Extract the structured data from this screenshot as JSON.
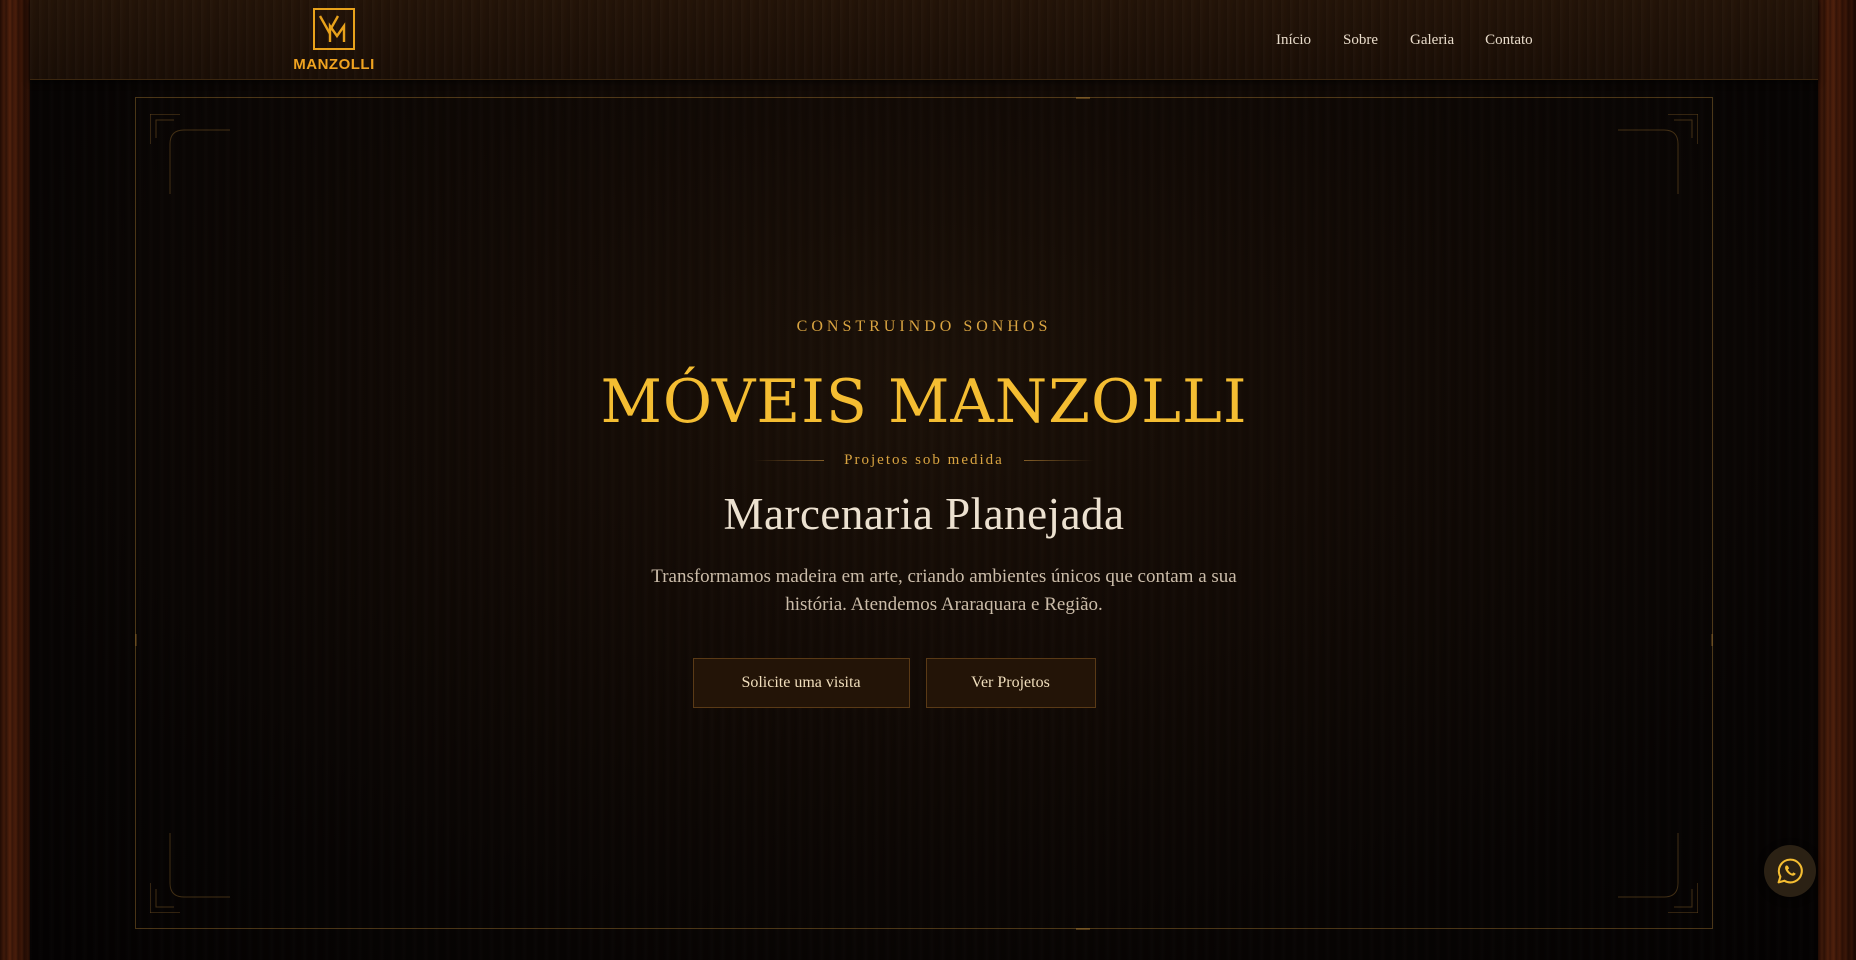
{
  "brand": {
    "logo_text": "MANZOLLI",
    "logo_icon": "vm-monogram-icon",
    "accent_color": "#f4bd32",
    "logo_color": "#e8a21b"
  },
  "nav": {
    "items": [
      {
        "label": "Início"
      },
      {
        "label": "Sobre"
      },
      {
        "label": "Galeria"
      },
      {
        "label": "Contato"
      }
    ]
  },
  "hero": {
    "eyebrow": "CONSTRUINDO SONHOS",
    "title": "MÓVEIS MANZOLLI",
    "tagline": "Projetos sob medida",
    "subtitle": "Marcenaria Planejada",
    "description": "Transformamos madeira em arte, criando ambientes únicos que contam a sua história. Atendemos Araraquara e Região.",
    "primary_cta": "Solicite uma visita",
    "secondary_cta": "Ver Projetos"
  },
  "floating": {
    "icon": "whatsapp-icon"
  }
}
